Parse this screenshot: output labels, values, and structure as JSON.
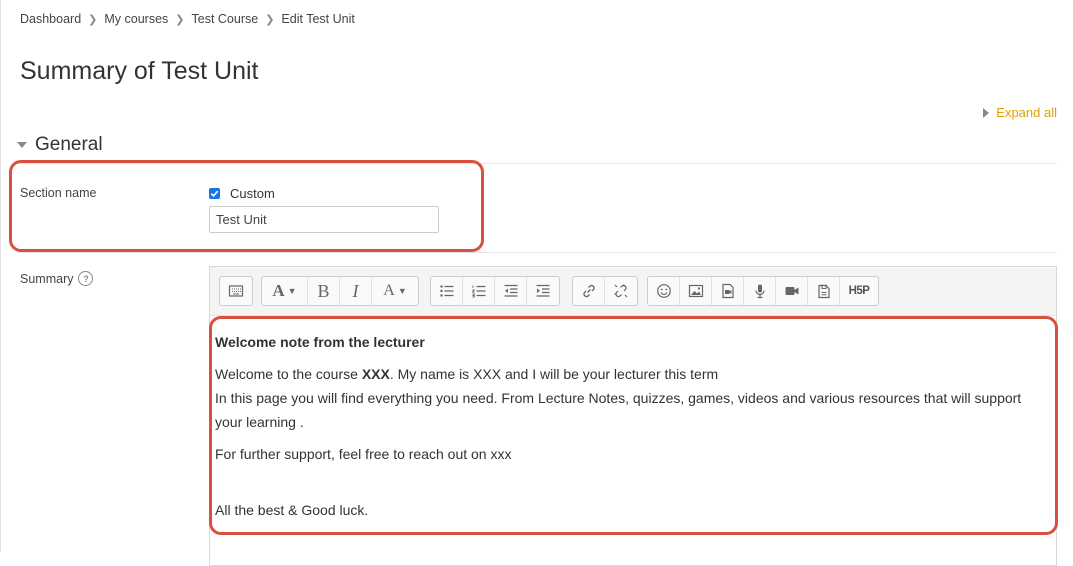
{
  "breadcrumb": {
    "items": [
      "Dashboard",
      "My courses",
      "Test Course",
      "Edit Test Unit"
    ]
  },
  "page": {
    "title": "Summary of Test Unit",
    "expand_all": "Expand all"
  },
  "general": {
    "title": "General"
  },
  "section_name": {
    "label": "Section name",
    "custom_label": "Custom",
    "custom_checked": true,
    "value": "Test Unit"
  },
  "summary": {
    "label": "Summary"
  },
  "toolbar": {
    "buttons": [
      "atto-collapse-icon",
      "font-style-icon",
      "bold-icon",
      "italic-icon",
      "font-color-icon",
      "unordered-list-icon",
      "ordered-list-icon",
      "outdent-icon",
      "indent-icon",
      "link-icon",
      "unlink-icon",
      "emoji-icon",
      "image-icon",
      "media-icon",
      "record-audio-icon",
      "record-video-icon",
      "manage-files-icon",
      "h5p-icon"
    ],
    "h5p_label": "H5P"
  },
  "editor": {
    "heading": "Welcome note from the lecturer",
    "para1_pre": "Welcome to the course ",
    "para1_bold": "XXX",
    "para1_post": ". My name is XXX and I will be your lecturer this term",
    "para2": "In this page you will find everything you need. From Lecture Notes, quizzes, games, videos and various resources that will support your learning .",
    "para3": "For further support, feel free to reach out on xxx",
    "para4": "All the best & Good luck."
  },
  "colors": {
    "accent": "#e0a100",
    "highlight": "#d9503f",
    "checkbox": "#1a73e8"
  }
}
